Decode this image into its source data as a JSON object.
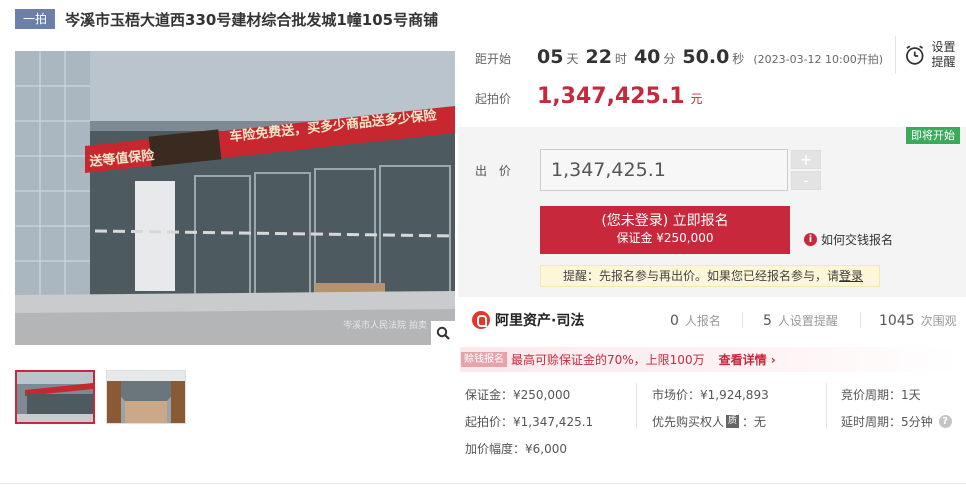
{
  "title": {
    "badge": "一拍",
    "text": "岑溪市玉梧大道西330号建材综合批发城1幢105号商铺"
  },
  "gallery": {
    "watermark": "岑溪市人民法院 拍卖",
    "thumbnails": 2
  },
  "countdown": {
    "label": "距开始",
    "days": "05",
    "days_unit": "天",
    "hours": "22",
    "hours_unit": "时",
    "minutes": "40",
    "minutes_unit": "分",
    "seconds": "50.0",
    "seconds_unit": "秒",
    "start_time": "(2023-03-12 10:00开拍)"
  },
  "reminder": {
    "label": "设置提醒"
  },
  "start_price": {
    "label": "起拍价",
    "value": "1,347,425.1",
    "unit": "元"
  },
  "bid": {
    "status_tag": "即将开始",
    "label": "出 价",
    "input_value": "1,347,425.1",
    "plus": "+",
    "minus": "-",
    "register_main": "(您未登录) 立即报名",
    "register_sub": "保证金 ¥250,000",
    "howto": "如何交钱报名",
    "notice_text": "提醒：先报名参与再出价。如果您已经报名参与，请",
    "notice_link": "登录"
  },
  "platform": {
    "name": "阿里资产·司法",
    "signups_num": "0",
    "signups_label": "人报名",
    "reminders_num": "5",
    "reminders_label": "人设置提醒",
    "views_num": "1045",
    "views_label": "次围观"
  },
  "loan": {
    "badge": "赊钱报名",
    "text": "最高可赊保证金的70%，上限100万",
    "link": "查看详情"
  },
  "details": {
    "deposit": "保证金：¥250,000",
    "market_price": "市场价：¥1,924,893",
    "bid_period": "竞价周期：1天",
    "start_price": "起拍价：¥1,347,425.1",
    "priority_label": "优先购买权人",
    "priority_icon": "质",
    "priority_value": "：无",
    "delay_period": "延时周期：5分钟",
    "increment": "加价幅度：¥6,000"
  },
  "colors": {
    "brand_red": "#c7283b",
    "badge_blue": "#6b7fa8",
    "status_green": "#3aaa5c"
  }
}
